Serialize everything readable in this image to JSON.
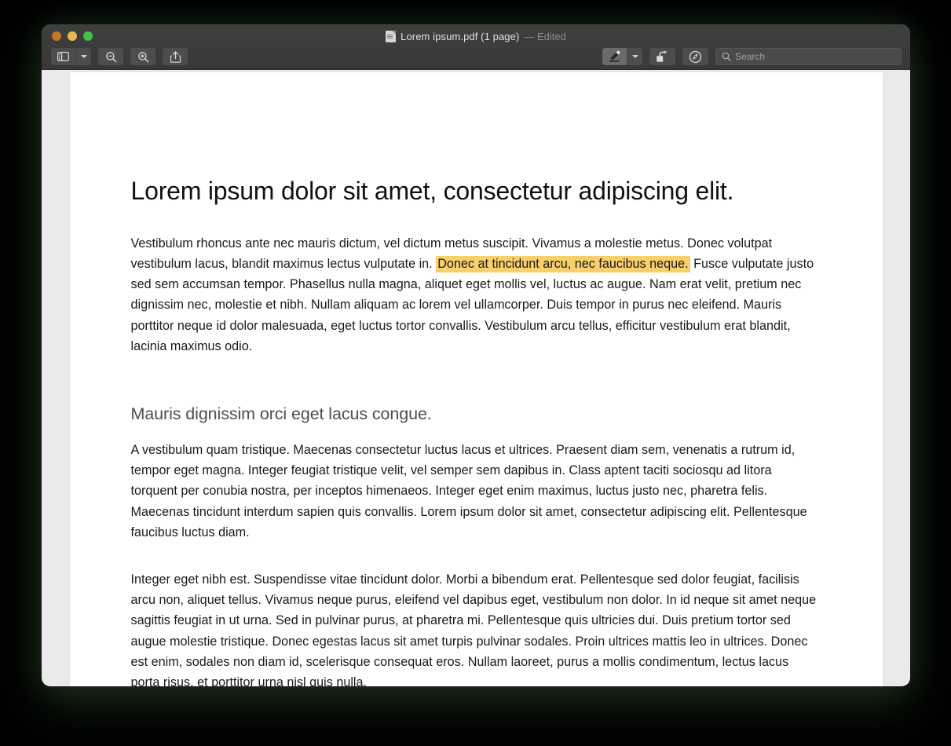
{
  "window": {
    "title_filename": "Lorem ipsum.pdf (1 page)",
    "title_status": "— Edited",
    "traffic_lights": [
      {
        "name": "close",
        "color": "#c0762b"
      },
      {
        "name": "minimize",
        "color": "#e7bc4e"
      },
      {
        "name": "maximize",
        "color": "#3fc24a"
      }
    ]
  },
  "toolbar": {
    "left": [
      {
        "id": "sidebar-toggle",
        "icon": "sidebar-icon",
        "has_chevron": true
      },
      {
        "id": "zoom-out",
        "icon": "magnifier-minus-icon"
      },
      {
        "id": "zoom-in",
        "icon": "magnifier-plus-icon"
      },
      {
        "id": "share",
        "icon": "share-icon"
      }
    ],
    "right": [
      {
        "id": "highlight-tool",
        "icon": "highlighter-pen-icon",
        "has_chevron": true,
        "active": true
      },
      {
        "id": "rotate",
        "icon": "rotate-right-icon"
      },
      {
        "id": "markup",
        "icon": "markup-pen-circle-icon"
      }
    ]
  },
  "search": {
    "placeholder": "Search",
    "value": "",
    "icon": "search-icon"
  },
  "document": {
    "heading": "Lorem ipsum dolor sit amet, consectetur adipiscing elit.",
    "paragraph1_before": "Vestibulum rhoncus ante nec mauris dictum, vel dictum metus suscipit. Vivamus a molestie metus. Donec volutpat vestibulum lacus, blandit maximus lectus vulputate in. ",
    "paragraph1_highlight": "Donec at tincidunt arcu, nec faucibus neque.",
    "paragraph1_after": " Fusce vulputate justo sed sem accumsan tempor. Phasellus nulla magna, aliquet eget mollis vel, luctus ac augue. Nam erat velit, pretium nec dignissim nec, molestie et nibh. Nullam aliquam ac lorem vel ullamcorper. Duis tempor in purus nec eleifend. Mauris porttitor neque id dolor malesuada, eget luctus tortor convallis. Vestibulum arcu tellus, efficitur vestibulum erat blandit, lacinia maximus odio.",
    "subheading": "Mauris dignissim orci eget lacus congue.",
    "paragraph2": "A vestibulum quam tristique. Maecenas consectetur luctus lacus et ultrices. Praesent diam sem, venenatis a rutrum id, tempor eget magna. Integer feugiat tristique velit, vel semper sem dapibus in. Class aptent taciti sociosqu ad litora torquent per conubia nostra, per inceptos himenaeos. Integer eget enim maximus, luctus justo nec, pharetra felis. Maecenas tincidunt interdum sapien quis convallis. Lorem ipsum dolor sit amet, consectetur adipiscing elit. Pellentesque faucibus luctus diam.",
    "paragraph3": "Integer eget nibh est. Suspendisse vitae tincidunt dolor. Morbi a bibendum erat. Pellentesque sed dolor feugiat, facilisis arcu non, aliquet tellus. Vivamus neque purus, eleifend vel dapibus eget, vestibulum non dolor. In id neque sit amet neque sagittis feugiat in ut urna. Sed in pulvinar purus, at pharetra mi. Pellentesque quis ultricies dui. Duis pretium tortor sed augue molestie tristique. Donec egestas lacus sit amet turpis pulvinar sodales. Proin ultrices mattis leo in ultrices. Donec est enim, sodales non diam id, scelerisque consequat eros. Nullam laoreet, purus a mollis condimentum, lectus lacus porta risus, et porttitor urna nisl quis nulla."
  },
  "colors": {
    "highlight": "#f7cf6b",
    "titlebar": "#3b3b3b",
    "viewer_background": "#eaeaea",
    "page": "#ffffff",
    "subheading_text": "#4e4e4e"
  }
}
